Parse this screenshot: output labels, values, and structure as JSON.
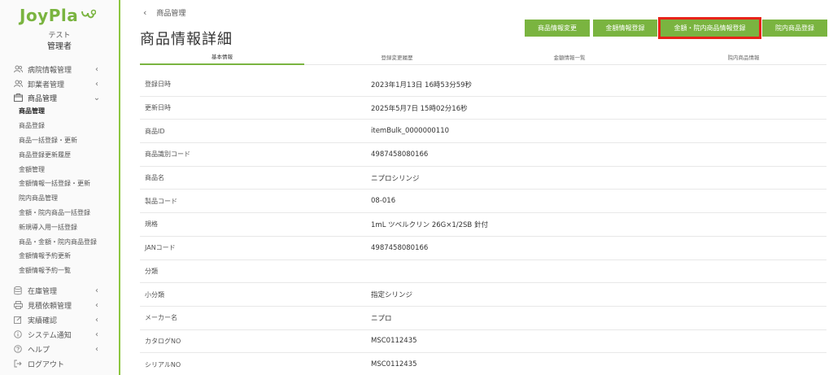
{
  "app": {
    "logo_text": "JoyPla"
  },
  "user": {
    "name": "テスト",
    "role": "管理者"
  },
  "sidebar": {
    "groups": [
      {
        "label": "病院情報管理",
        "icon": "users-icon"
      },
      {
        "label": "卸業者管理",
        "icon": "users-icon"
      },
      {
        "label": "商品管理",
        "icon": "box-icon"
      },
      {
        "label": "在庫管理",
        "icon": "database-icon"
      },
      {
        "label": "見積依頼管理",
        "icon": "printer-icon"
      },
      {
        "label": "実績確認",
        "icon": "edit-icon"
      },
      {
        "label": "システム通知",
        "icon": "info-icon"
      },
      {
        "label": "ヘルプ",
        "icon": "help-icon"
      },
      {
        "label": "ログアウト",
        "icon": "logout-icon"
      }
    ],
    "product_items": [
      "商品管理",
      "商品登録",
      "商品一括登録・更新",
      "商品登録更新履歴",
      "金額管理",
      "金額情報一括登録・更新",
      "院内商品管理",
      "金額・院内商品一括登録",
      "新規導入用一括登録",
      "商品・金額・院内商品登録",
      "金額情報予約更新",
      "金額情報予約一覧"
    ]
  },
  "breadcrumb": {
    "label": "商品管理"
  },
  "page": {
    "title": "商品情報詳細"
  },
  "actions": [
    "商品情報変更",
    "金額情報登録",
    "金額・院内商品情報登録",
    "院内商品登録"
  ],
  "tabs": [
    "基本情報",
    "登録変更履歴",
    "金額情報一覧",
    "院内商品情報"
  ],
  "details": [
    {
      "label": "登録日時",
      "value": "2023年1月13日 16時53分59秒"
    },
    {
      "label": "更新日時",
      "value": "2025年5月7日 15時02分16秒"
    },
    {
      "label": "商品ID",
      "value": "itemBulk_0000000110"
    },
    {
      "label": "商品識別コード",
      "value": "4987458080166"
    },
    {
      "label": "商品名",
      "value": "ニプロシリンジ"
    },
    {
      "label": "製品コード",
      "value": "08-016"
    },
    {
      "label": "規格",
      "value": "1mL ツベルクリン 26G×1/2SB 針付"
    },
    {
      "label": "JANコード",
      "value": "4987458080166"
    },
    {
      "label": "分類",
      "value": ""
    },
    {
      "label": "小分類",
      "value": "指定シリンジ"
    },
    {
      "label": "メーカー名",
      "value": "ニプロ"
    },
    {
      "label": "カタログNO",
      "value": "MSC0112435"
    },
    {
      "label": "シリアルNO",
      "value": "MSC0112435"
    }
  ],
  "colors": {
    "accent": "#7ab440",
    "highlight": "#e8231a"
  }
}
